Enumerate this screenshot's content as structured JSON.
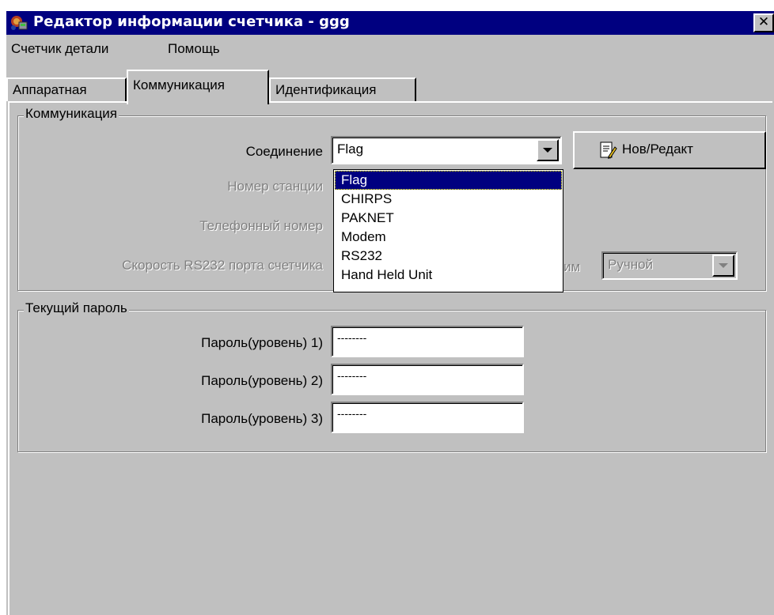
{
  "window": {
    "title": "Редактор информации счетчика - ggg",
    "close_label": "✕",
    "app_icon": "meter-app-icon"
  },
  "menu": {
    "items": [
      "Счетчик детали",
      "Помощь"
    ]
  },
  "tabs": {
    "items": [
      "Аппаратная",
      "Коммуникация",
      "Идентификация"
    ],
    "active": "Коммуникация"
  },
  "communication": {
    "group_title": "Коммуникация",
    "connection_label": "Соединение",
    "connection_value": "Flag",
    "new_edit_button": "Нов/Редакт",
    "station_label": "Номер станции",
    "phone_label": "Телефонный номер",
    "rs232_speed_label": "Скорость RS232 порта счетчика",
    "mode_label_partial": "им",
    "mode_value": "Ручной",
    "connection_options": [
      "Flag",
      "CHIRPS",
      "PAKNET",
      "Modem",
      "RS232",
      "Hand Held Unit"
    ],
    "selected_option": "Flag"
  },
  "password": {
    "group_title": "Текущий пароль",
    "fields": [
      {
        "label": "Пароль(уровень) 1)",
        "value": "--------"
      },
      {
        "label": "Пароль(уровень) 2)",
        "value": "--------"
      },
      {
        "label": "Пароль(уровень) 3)",
        "value": "--------"
      }
    ]
  },
  "colors": {
    "title_bar": "#000080",
    "face": "#c0c0c0",
    "selection": "#000080",
    "disabled_text": "#808080"
  }
}
